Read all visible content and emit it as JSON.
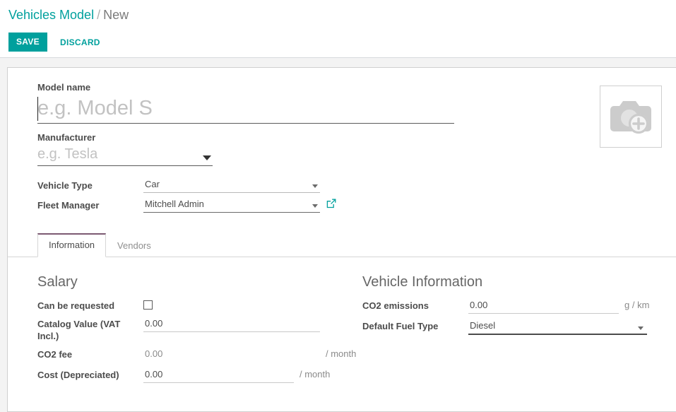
{
  "breadcrumb": {
    "root": "Vehicles Model",
    "separator": "/",
    "current": "New"
  },
  "actions": {
    "save_label": "SAVE",
    "discard_label": "DISCARD",
    "accent_color": "#00a09d"
  },
  "image_placeholder": {
    "icon": "camera-plus-icon",
    "color": "#cccccc"
  },
  "form": {
    "model_name": {
      "label": "Model name",
      "value": "",
      "placeholder": "e.g. Model S"
    },
    "manufacturer": {
      "label": "Manufacturer",
      "value": "",
      "placeholder": "e.g. Tesla"
    },
    "vehicle_type": {
      "label": "Vehicle Type",
      "value": "Car"
    },
    "fleet_manager": {
      "label": "Fleet Manager",
      "value": "Mitchell Admin",
      "external_link_icon": "external-link-icon"
    }
  },
  "notebook": {
    "tabs": [
      {
        "label": "Information",
        "active": true
      },
      {
        "label": "Vendors",
        "active": false
      }
    ],
    "active_tab_border_color": "#7c5a72"
  },
  "salary": {
    "title": "Salary",
    "fields": [
      {
        "label": "Can be requested",
        "type": "checkbox",
        "checked": false
      },
      {
        "label": "Catalog Value (VAT Incl.)",
        "type": "number",
        "value": "0.00",
        "suffix": "",
        "readonly": false
      },
      {
        "label": "CO2 fee",
        "type": "number",
        "value": "0.00",
        "suffix": "/ month",
        "readonly": true
      },
      {
        "label": "Cost (Depreciated)",
        "type": "number",
        "value": "0.00",
        "suffix": "/ month",
        "readonly": false
      }
    ]
  },
  "vehicle_information": {
    "title": "Vehicle Information",
    "fields": [
      {
        "label": "CO2 emissions",
        "type": "number",
        "value": "0.00",
        "suffix": "g / km",
        "readonly": false
      },
      {
        "label": "Default Fuel Type",
        "type": "select",
        "value": "Diesel",
        "suffix": ""
      }
    ]
  }
}
